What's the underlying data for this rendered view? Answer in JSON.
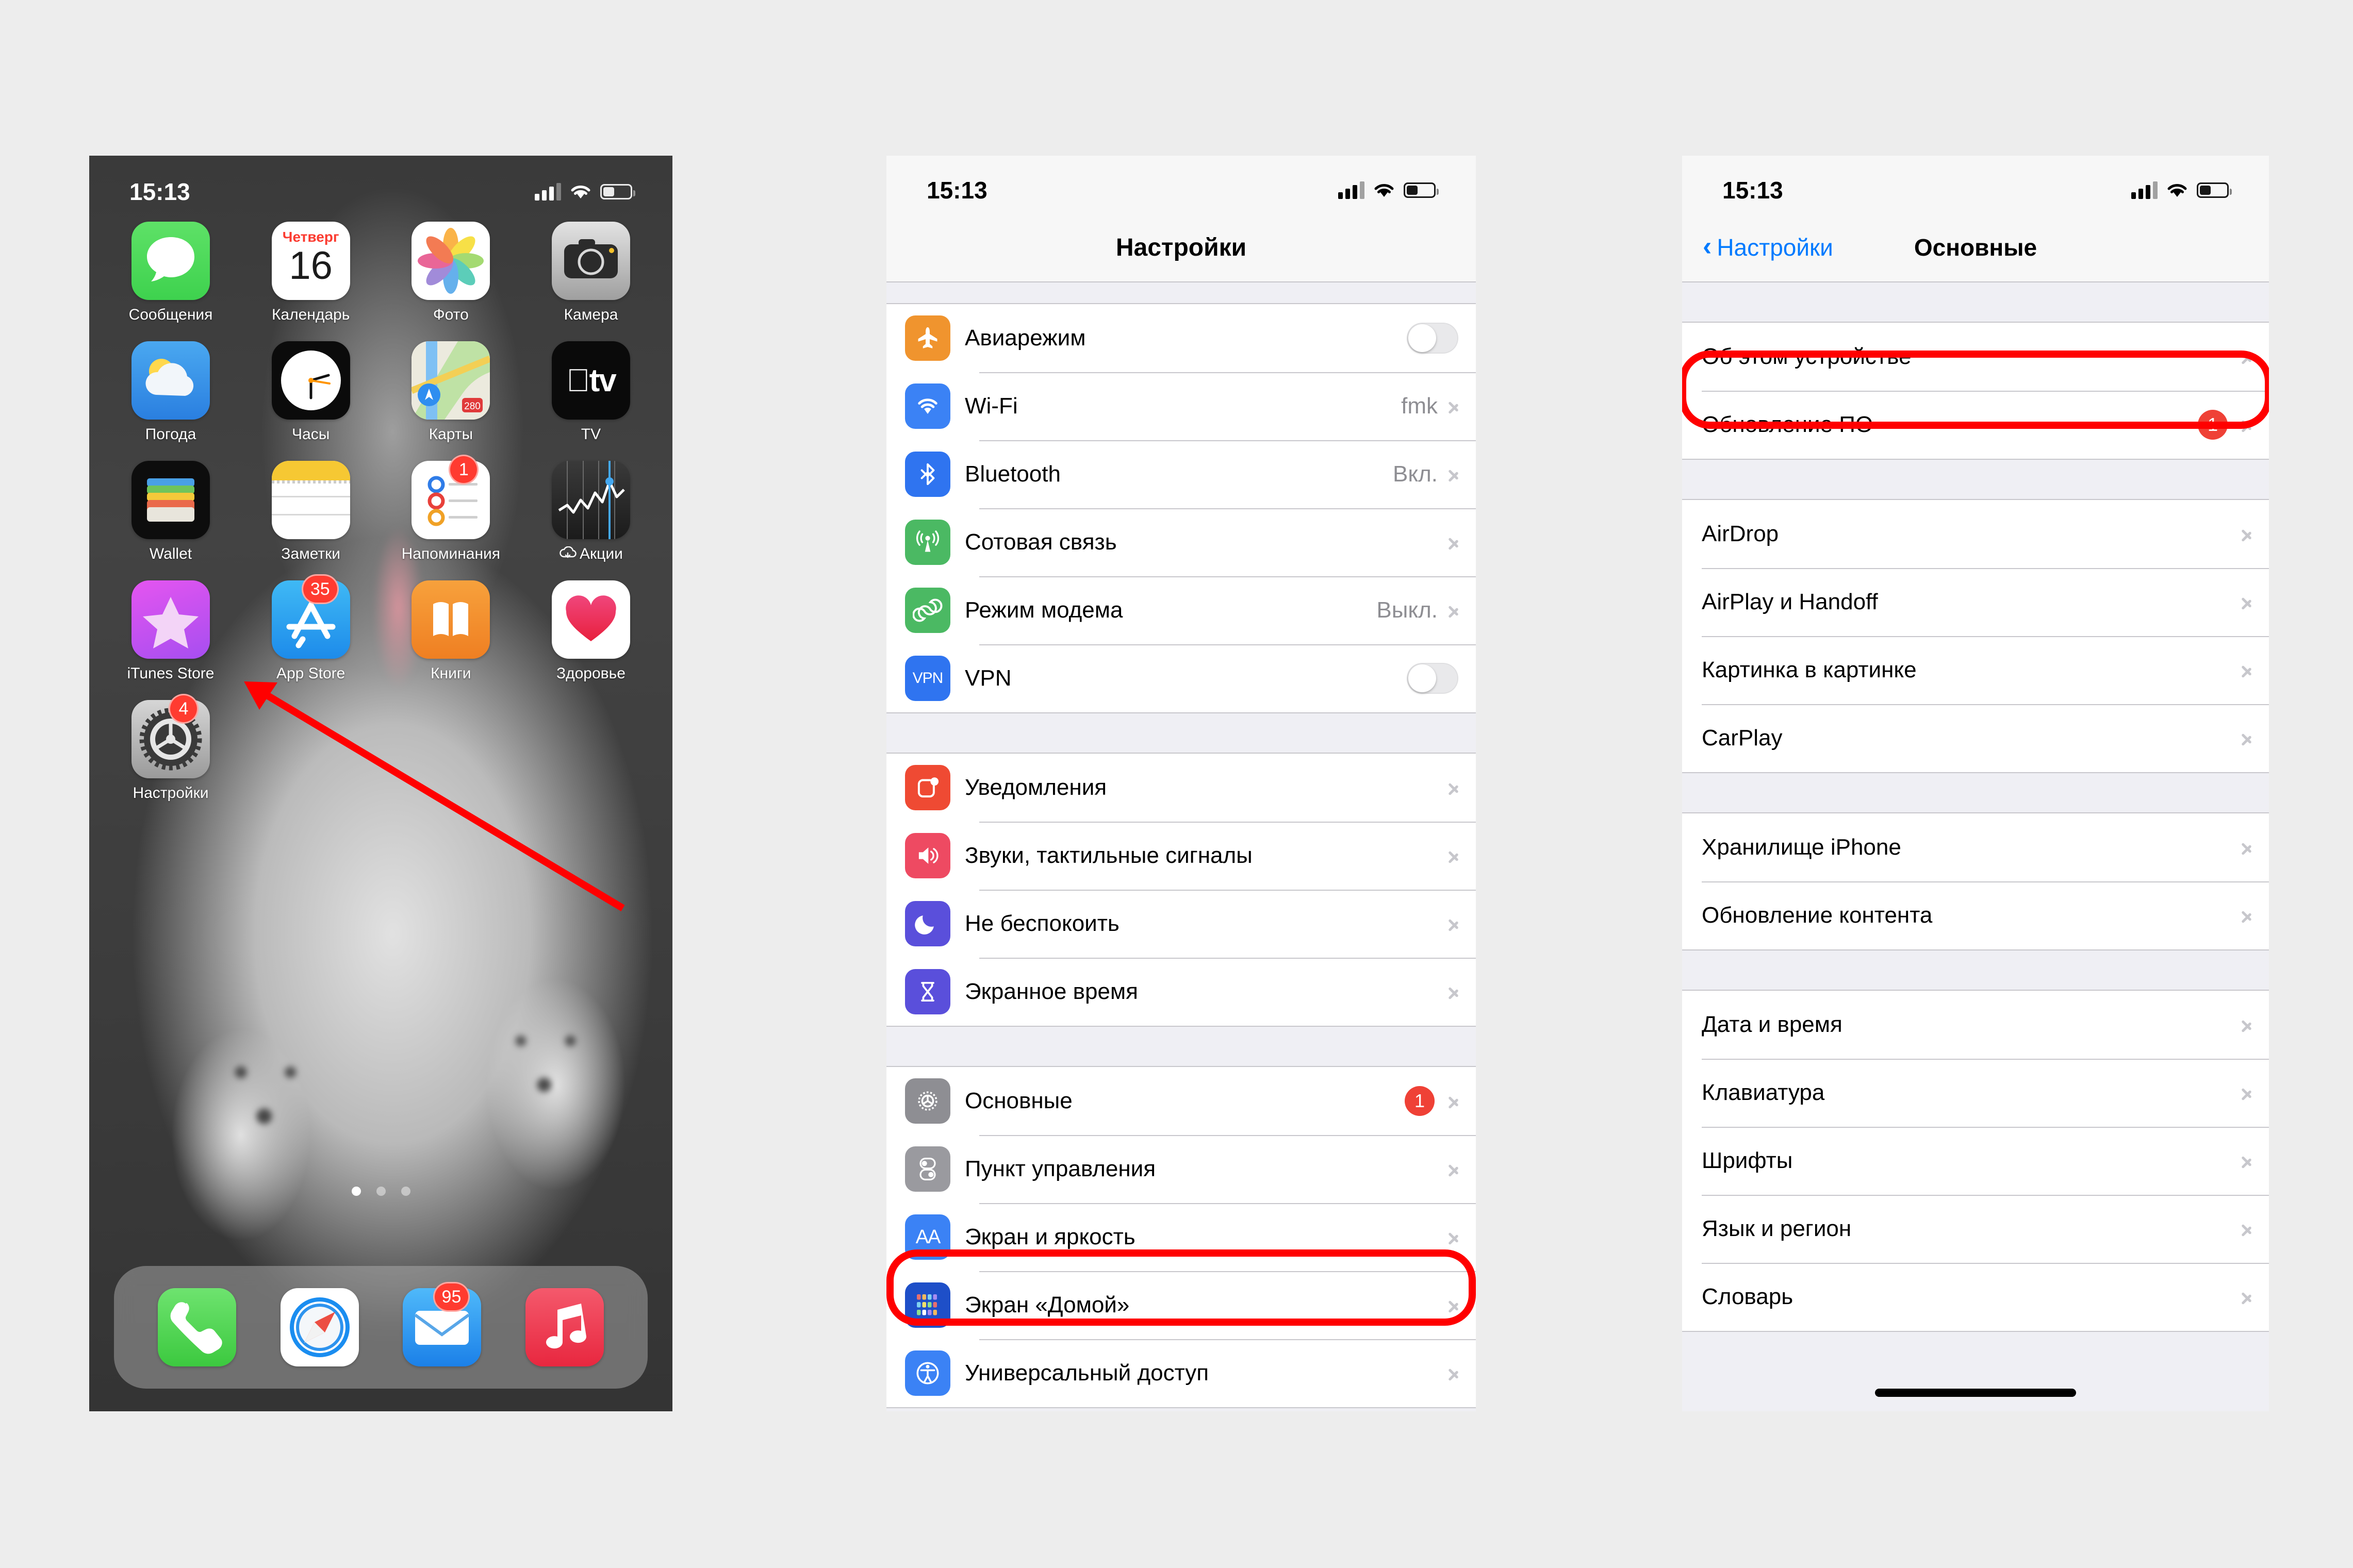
{
  "colors": {
    "accent_blue": "#007aff",
    "badge_red": "#ef4136",
    "highlight_red": "#ff0000",
    "page_background": "#ededed",
    "list_background": "#efeff4"
  },
  "phone_home": {
    "status": {
      "time": "15:13",
      "signal_icon": "cellular-bars-icon",
      "wifi_icon": "wifi-icon",
      "battery_icon": "battery-icon"
    },
    "rows": [
      [
        {
          "label": "Сообщения",
          "icon": "messages-icon",
          "badge": null
        },
        {
          "label": "Календарь",
          "icon": "calendar-icon",
          "badge": null,
          "weekday": "Четверг",
          "day": "16"
        },
        {
          "label": "Фото",
          "icon": "photos-icon",
          "badge": null
        },
        {
          "label": "Камера",
          "icon": "camera-icon",
          "badge": null
        }
      ],
      [
        {
          "label": "Погода",
          "icon": "weather-icon",
          "badge": null
        },
        {
          "label": "Часы",
          "icon": "clock-icon",
          "badge": null
        },
        {
          "label": "Карты",
          "icon": "maps-icon",
          "badge": null
        },
        {
          "label": "TV",
          "icon": "apple-tv-icon",
          "badge": null
        }
      ],
      [
        {
          "label": "Wallet",
          "icon": "wallet-icon",
          "badge": null
        },
        {
          "label": "Заметки",
          "icon": "notes-icon",
          "badge": null
        },
        {
          "label": "Напоминания",
          "icon": "reminders-icon",
          "badge": "1"
        },
        {
          "label": "Акции",
          "icon": "stocks-icon",
          "badge": null,
          "cloud": true
        }
      ],
      [
        {
          "label": "iTunes Store",
          "icon": "itunes-store-icon",
          "badge": null
        },
        {
          "label": "App Store",
          "icon": "app-store-icon",
          "badge": "35"
        },
        {
          "label": "Книги",
          "icon": "books-icon",
          "badge": null
        },
        {
          "label": "Здоровье",
          "icon": "health-icon",
          "badge": null
        }
      ],
      [
        {
          "label": "Настройки",
          "icon": "settings-icon",
          "badge": "4"
        }
      ]
    ],
    "page_dots": {
      "count": 3,
      "active": 1
    },
    "dock": [
      {
        "label": "Телефон",
        "icon": "phone-icon",
        "badge": null
      },
      {
        "label": "Safari",
        "icon": "safari-icon",
        "badge": null
      },
      {
        "label": "Почта",
        "icon": "mail-icon",
        "badge": "95"
      },
      {
        "label": "Музыка",
        "icon": "music-icon",
        "badge": null
      }
    ],
    "annotation": {
      "type": "arrow",
      "color": "#ff0000",
      "points_to": "settings-icon"
    }
  },
  "phone_settings": {
    "status": {
      "time": "15:13",
      "signal_icon": "cellular-bars-icon",
      "wifi_icon": "wifi-icon",
      "battery_icon": "battery-icon"
    },
    "nav": {
      "title": "Настройки"
    },
    "groups": [
      {
        "rows": [
          {
            "label": "Авиарежим",
            "icon": "airplane-icon",
            "accessory": "toggle",
            "toggle_on": false,
            "value": null,
            "badge": null
          },
          {
            "label": "Wi-Fi",
            "icon": "wifi-settings-icon",
            "accessory": "chevron",
            "value": "fmk",
            "badge": null
          },
          {
            "label": "Bluetooth",
            "icon": "bluetooth-icon",
            "accessory": "chevron",
            "value": "Вкл.",
            "badge": null
          },
          {
            "label": "Сотовая связь",
            "icon": "cellular-icon",
            "accessory": "chevron",
            "value": null,
            "badge": null
          },
          {
            "label": "Режим модема",
            "icon": "hotspot-icon",
            "accessory": "chevron",
            "value": "Выкл.",
            "badge": null
          },
          {
            "label": "VPN",
            "icon": "vpn-icon",
            "accessory": "toggle",
            "toggle_on": false,
            "value": null,
            "badge": null
          }
        ]
      },
      {
        "rows": [
          {
            "label": "Уведомления",
            "icon": "notifications-icon",
            "accessory": "chevron",
            "value": null,
            "badge": null
          },
          {
            "label": "Звуки, тактильные сигналы",
            "icon": "sounds-icon",
            "accessory": "chevron",
            "value": null,
            "badge": null
          },
          {
            "label": "Не беспокоить",
            "icon": "do-not-disturb-icon",
            "accessory": "chevron",
            "value": null,
            "badge": null
          },
          {
            "label": "Экранное время",
            "icon": "screen-time-icon",
            "accessory": "chevron",
            "value": null,
            "badge": null
          }
        ]
      },
      {
        "rows": [
          {
            "label": "Основные",
            "icon": "general-icon",
            "accessory": "chevron",
            "value": null,
            "badge": "1",
            "highlighted": true
          },
          {
            "label": "Пункт управления",
            "icon": "control-center-icon",
            "accessory": "chevron",
            "value": null,
            "badge": null
          },
          {
            "label": "Экран и яркость",
            "icon": "display-brightness-icon",
            "accessory": "chevron",
            "value": null,
            "badge": null
          },
          {
            "label": "Экран «Домой»",
            "icon": "home-screen-icon",
            "accessory": "chevron",
            "value": null,
            "badge": null
          },
          {
            "label": "Универсальный доступ",
            "icon": "accessibility-icon",
            "accessory": "chevron",
            "value": null,
            "badge": null,
            "redacted": true
          }
        ]
      }
    ]
  },
  "phone_general": {
    "status": {
      "time": "15:13",
      "signal_icon": "cellular-bars-icon",
      "wifi_icon": "wifi-icon",
      "battery_icon": "battery-icon"
    },
    "nav": {
      "back_label": "Настройки",
      "title": "Основные",
      "back_icon": "chevron-left-icon"
    },
    "groups": [
      {
        "rows": [
          {
            "label": "Об этом устройстве",
            "accessory": "chevron",
            "badge": null,
            "highlighted": true
          },
          {
            "label": "Обновление ПО",
            "accessory": "chevron",
            "badge": "1"
          }
        ]
      },
      {
        "rows": [
          {
            "label": "AirDrop",
            "accessory": "chevron",
            "badge": null
          },
          {
            "label": "AirPlay и Handoff",
            "accessory": "chevron",
            "badge": null
          },
          {
            "label": "Картинка в картинке",
            "accessory": "chevron",
            "badge": null
          },
          {
            "label": "CarPlay",
            "accessory": "chevron",
            "badge": null
          }
        ]
      },
      {
        "rows": [
          {
            "label": "Хранилище iPhone",
            "accessory": "chevron",
            "badge": null
          },
          {
            "label": "Обновление контента",
            "accessory": "chevron",
            "badge": null
          }
        ]
      },
      {
        "rows": [
          {
            "label": "Дата и время",
            "accessory": "chevron",
            "badge": null
          },
          {
            "label": "Клавиатура",
            "accessory": "chevron",
            "badge": null
          },
          {
            "label": "Шрифты",
            "accessory": "chevron",
            "badge": null
          },
          {
            "label": "Язык и регион",
            "accessory": "chevron",
            "badge": null
          },
          {
            "label": "Словарь",
            "accessory": "chevron",
            "badge": null
          }
        ]
      }
    ]
  }
}
